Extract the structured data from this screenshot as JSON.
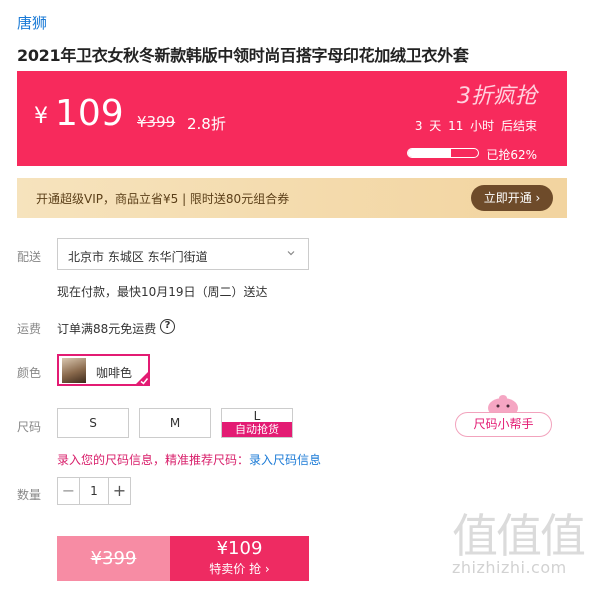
{
  "brand": "唐狮",
  "product_title": "2021年卫衣女秋冬新款韩版中领时尚百搭字母印花加绒卫衣外套",
  "price_banner": {
    "currency": "¥",
    "price": "109",
    "original_price": "¥399",
    "discount": "2.8折",
    "flash_label": "3折疯抢",
    "countdown": "3 天 11 小时 后结束",
    "sold_percent": 62,
    "sold_text": "已抢62%"
  },
  "vip": {
    "text": "开通超级VIP，商品立省¥5 | 限时送80元组合券",
    "button_label": "立即开通 ›"
  },
  "delivery": {
    "label": "配送",
    "location": "北京市 东城区 东华门街道",
    "eta": "现在付款，最快10月19日（周二）送达"
  },
  "shipping": {
    "label": "运费",
    "text": "订单满88元免运费",
    "help_glyph": "?"
  },
  "color": {
    "label": "颜色",
    "selected": "咖啡色"
  },
  "size": {
    "label": "尺码",
    "options": [
      "S",
      "M",
      "L"
    ],
    "l_badge": "自动抢货",
    "helper_label": "尺码小帮手",
    "tip": "录入您的尺码信息，精准推荐尺码：",
    "tip_link": "录入尺码信息"
  },
  "quantity": {
    "label": "数量",
    "minus": "−",
    "value": "1",
    "plus": "+"
  },
  "buy": {
    "original_price": "¥399",
    "price": "¥109",
    "label": "特卖价 抢 ›"
  },
  "watermark": {
    "glyphs": "值值值",
    "url": "zhizhizhi.com"
  },
  "colors": {
    "accent_pink": "#f72a5c",
    "magenta": "#e31b73",
    "link_blue": "#1a7ad6",
    "vip_brown": "#6e4b2a"
  }
}
